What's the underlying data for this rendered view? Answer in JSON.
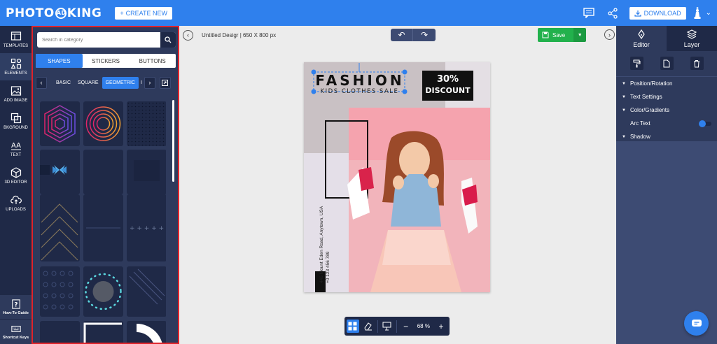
{
  "header": {
    "logo_part1": "PHOTO",
    "logo_ad": "AD",
    "logo_part2": "KING",
    "create_new": "CREATE NEW",
    "download": "DOWNLOAD"
  },
  "leftnav": {
    "items": [
      {
        "label": "TEMPLATES"
      },
      {
        "label": "ELEMENTS"
      },
      {
        "label": "ADD IMAGE"
      },
      {
        "label": "BKGROUND"
      },
      {
        "label": "TEXT"
      },
      {
        "label": "3D EDITOR"
      },
      {
        "label": "UPLOADS"
      }
    ],
    "bottom": [
      {
        "label": "How-To Guide"
      },
      {
        "label": "Shortcut Keys"
      }
    ]
  },
  "panel": {
    "search_placeholder": "Search in category",
    "tabs": [
      "SHAPES",
      "STICKERS",
      "BUTTONS"
    ],
    "subtabs": [
      "BASIC",
      "SQUARE",
      "GEOMETRIC",
      "I"
    ]
  },
  "toolbar": {
    "doc_title": "Untitled Desigr",
    "doc_size": "650 X 800 px",
    "save": "Save"
  },
  "design": {
    "title": "FASHION",
    "subtitle": "KIDS CLOTHES SALE",
    "discount_pct": "30%",
    "discount_word": "DISCOUNT",
    "address": "446 Mount Eden Road, Anytown, USA",
    "phone": "+0 123 456 789"
  },
  "zoom": {
    "value": "68 %"
  },
  "rightpanel": {
    "tabs": [
      "Editor",
      "Layer"
    ],
    "sections": [
      "Position/Rotation",
      "Text Settings",
      "Color/Gradients",
      "Arc Text",
      "Shadow"
    ]
  },
  "colors": {
    "brand": "#2f80ed",
    "nav": "#1f2947",
    "panel": "#2e3a5c",
    "save": "#22b14c",
    "highlight": "#e0232a"
  }
}
